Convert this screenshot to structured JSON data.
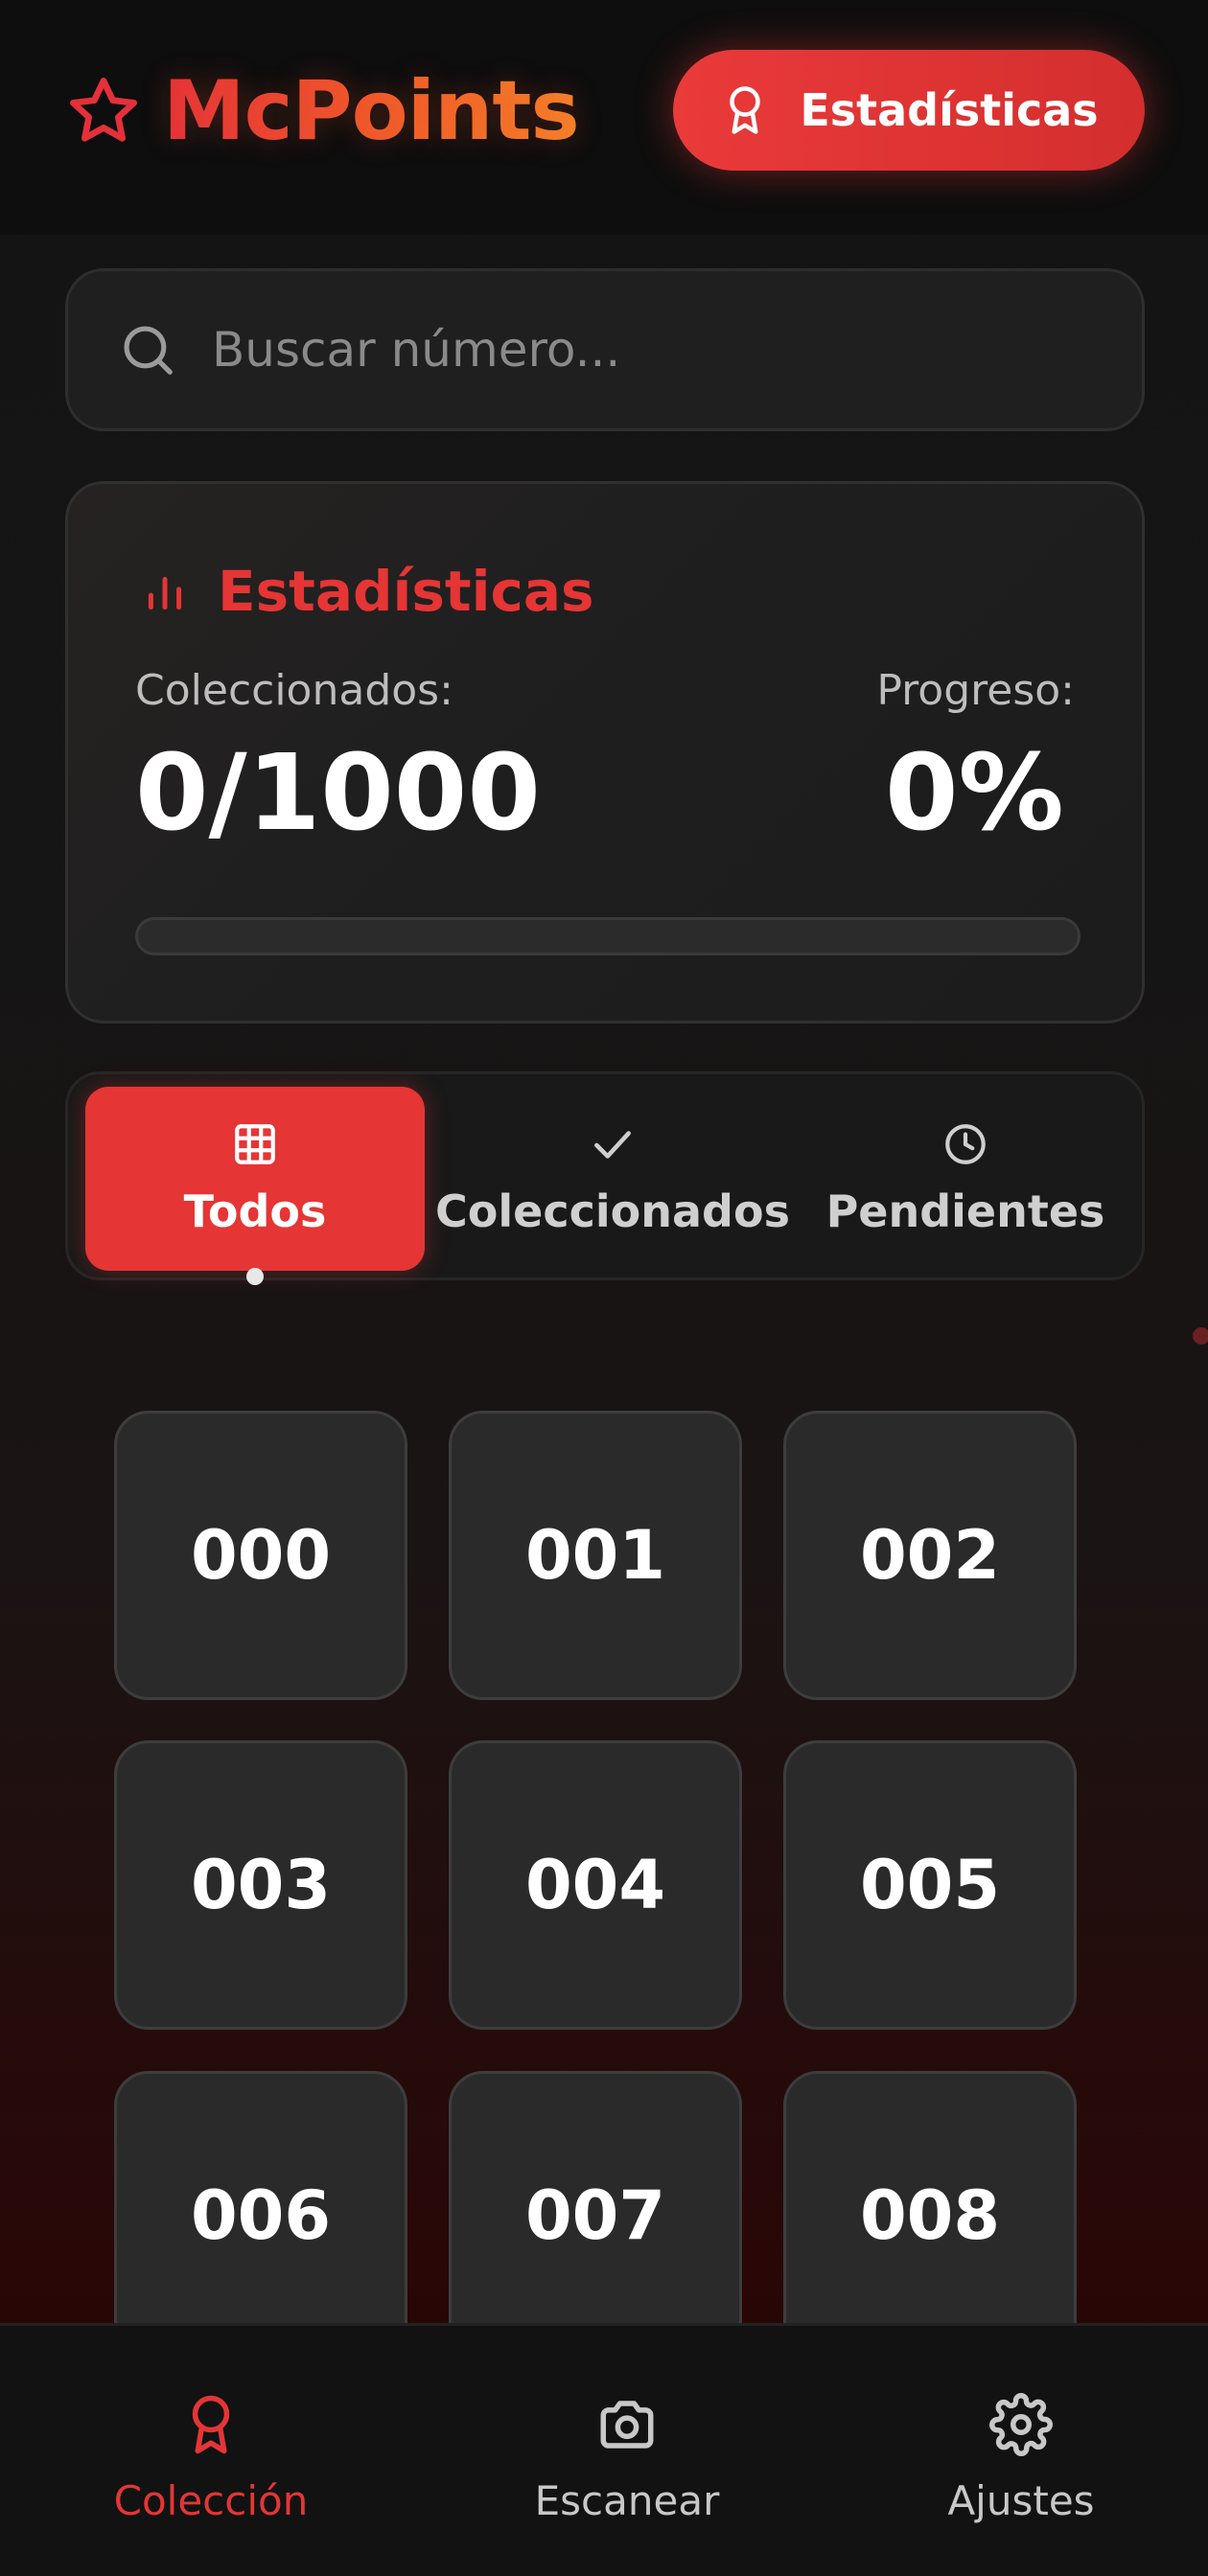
{
  "header": {
    "brand": "McPoints",
    "stats_button": "Estadísticas"
  },
  "search": {
    "placeholder": "Buscar número..."
  },
  "stats": {
    "title": "Estadísticas",
    "collected_label": "Coleccionados:",
    "collected_value": "0/1000",
    "progress_label": "Progreso:",
    "progress_value": "0%",
    "progress_fraction": 0
  },
  "tabs": [
    {
      "label": "Todos",
      "icon": "grid-icon",
      "active": true
    },
    {
      "label": "Coleccionados",
      "icon": "check-icon",
      "active": false
    },
    {
      "label": "Pendientes",
      "icon": "clock-icon",
      "active": false
    }
  ],
  "grid": [
    "000",
    "001",
    "002",
    "003",
    "004",
    "005",
    "006",
    "007",
    "008"
  ],
  "bottom_nav": [
    {
      "label": "Colección",
      "icon": "award-icon",
      "active": true
    },
    {
      "label": "Escanear",
      "icon": "camera-icon",
      "active": false
    },
    {
      "label": "Ajustes",
      "icon": "gear-icon",
      "active": false
    }
  ],
  "colors": {
    "accent": "#e53535",
    "brand_gradient_end": "#f5842a",
    "tile_bg": "#2a2a2a"
  }
}
